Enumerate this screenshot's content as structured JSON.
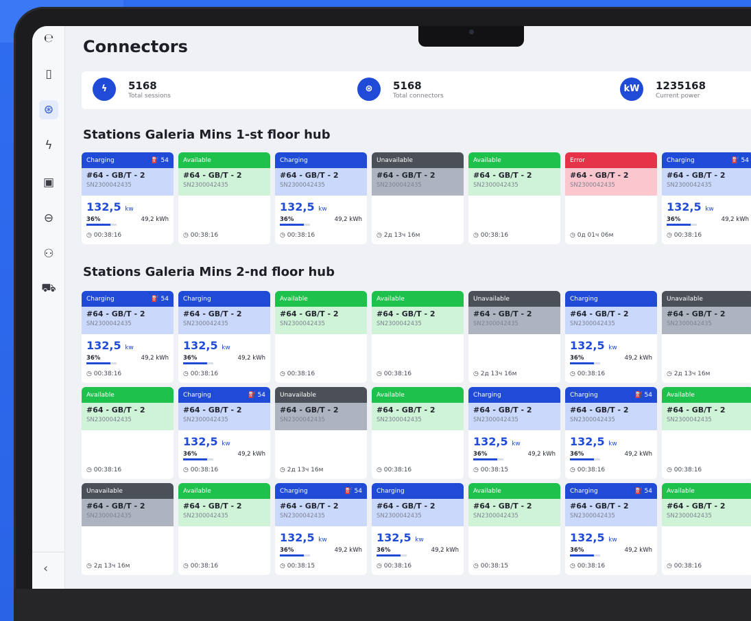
{
  "page": {
    "title": "Connectors"
  },
  "stats": [
    {
      "icon": "bolt-icon",
      "glyph": "ϟ",
      "value": "5168",
      "label": "Total sessions"
    },
    {
      "icon": "connector-icon",
      "glyph": "⊛",
      "value": "5168",
      "label": "Total connectors"
    },
    {
      "icon": "kw-icon",
      "glyph": "kW",
      "value": "1235168",
      "label": "Current power"
    }
  ],
  "sections": [
    {
      "title": "Stations Galeria Mins 1-st floor hub",
      "cards": [
        {
          "status": "Charging",
          "type": "charging",
          "conn": "⛽ 54",
          "name": "#64 - GB/T - 2",
          "sn": "SN2300042435",
          "power": "132,5",
          "unit": "kw",
          "pct": "36%",
          "pct_value": 0.36,
          "kwh": "49,2 kWh",
          "time": "00:38:16"
        },
        {
          "status": "Available",
          "type": "available",
          "conn": "",
          "name": "#64 - GB/T - 2",
          "sn": "SN2300042435",
          "power": "",
          "unit": "",
          "pct": "",
          "pct_value": 0,
          "kwh": "",
          "time": "00:38:16"
        },
        {
          "status": "Charging",
          "type": "charging",
          "conn": "",
          "name": "#64 - GB/T - 2",
          "sn": "SN2300042435",
          "power": "132,5",
          "unit": "kw",
          "pct": "36%",
          "pct_value": 0.36,
          "kwh": "49,2 kWh",
          "time": "00:38:16"
        },
        {
          "status": "Unavailable",
          "type": "unavailable",
          "conn": "",
          "name": "#64 - GB/T - 2",
          "sn": "SN2300042435",
          "power": "",
          "unit": "",
          "pct": "",
          "pct_value": 0,
          "kwh": "",
          "time": "2д 13ч 16м"
        },
        {
          "status": "Available",
          "type": "available",
          "conn": "",
          "name": "#64 - GB/T - 2",
          "sn": "SN2300042435",
          "power": "",
          "unit": "",
          "pct": "",
          "pct_value": 0,
          "kwh": "",
          "time": "00:38:16"
        },
        {
          "status": "Error",
          "type": "error",
          "conn": "",
          "name": "#64 - GB/T - 2",
          "sn": "SN2300042435",
          "power": "",
          "unit": "",
          "pct": "",
          "pct_value": 0,
          "kwh": "",
          "time": "0д 01ч 06м"
        },
        {
          "status": "Charging",
          "type": "charging",
          "conn": "⛽ 54",
          "name": "#64 - GB/T - 2",
          "sn": "SN2300042435",
          "power": "132,5",
          "unit": "kw",
          "pct": "36%",
          "pct_value": 0.36,
          "kwh": "49,2 kWh",
          "time": "00:38:16"
        }
      ]
    },
    {
      "title": "Stations Galeria Mins 2-nd floor hub",
      "cards": [
        {
          "status": "Charging",
          "type": "charging",
          "conn": "⛽ 54",
          "name": "#64 - GB/T - 2",
          "sn": "SN2300042435",
          "power": "132,5",
          "unit": "kw",
          "pct": "36%",
          "pct_value": 0.36,
          "kwh": "49,2 kWh",
          "time": "00:38:16"
        },
        {
          "status": "Charging",
          "type": "charging",
          "conn": "",
          "name": "#64 - GB/T - 2",
          "sn": "SN2300042435",
          "power": "132,5",
          "unit": "kw",
          "pct": "36%",
          "pct_value": 0.36,
          "kwh": "49,2 kWh",
          "time": "00:38:16"
        },
        {
          "status": "Available",
          "type": "available",
          "conn": "",
          "name": "#64 - GB/T - 2",
          "sn": "SN2300042435",
          "power": "",
          "unit": "",
          "pct": "",
          "pct_value": 0,
          "kwh": "",
          "time": "00:38:16"
        },
        {
          "status": "Available",
          "type": "available",
          "conn": "",
          "name": "#64 - GB/T - 2",
          "sn": "SN2300042435",
          "power": "",
          "unit": "",
          "pct": "",
          "pct_value": 0,
          "kwh": "",
          "time": "00:38:16"
        },
        {
          "status": "Unavailable",
          "type": "unavailable",
          "conn": "",
          "name": "#64 - GB/T - 2",
          "sn": "SN2300042435",
          "power": "",
          "unit": "",
          "pct": "",
          "pct_value": 0,
          "kwh": "",
          "time": "2д 13ч 16м"
        },
        {
          "status": "Charging",
          "type": "charging",
          "conn": "",
          "name": "#64 - GB/T - 2",
          "sn": "SN2300042435",
          "power": "132,5",
          "unit": "kw",
          "pct": "36%",
          "pct_value": 0.36,
          "kwh": "49,2 kWh",
          "time": "00:38:16"
        },
        {
          "status": "Unavailable",
          "type": "unavailable",
          "conn": "",
          "name": "#64 - GB/T - 2",
          "sn": "SN2300042435",
          "power": "",
          "unit": "",
          "pct": "",
          "pct_value": 0,
          "kwh": "",
          "time": "2д 13ч 16м"
        },
        {
          "status": "Available",
          "type": "available",
          "conn": "",
          "name": "#64 - GB/T - 2",
          "sn": "SN2300042435",
          "power": "",
          "unit": "",
          "pct": "",
          "pct_value": 0,
          "kwh": "",
          "time": "00:38:16"
        },
        {
          "status": "Charging",
          "type": "charging",
          "conn": "⛽ 54",
          "name": "#64 - GB/T - 2",
          "sn": "SN2300042435",
          "power": "132,5",
          "unit": "kw",
          "pct": "36%",
          "pct_value": 0.36,
          "kwh": "49,2 kWh",
          "time": "00:38:16"
        },
        {
          "status": "Unavailable",
          "type": "unavailable",
          "conn": "",
          "name": "#64 - GB/T - 2",
          "sn": "SN2300042435",
          "power": "",
          "unit": "",
          "pct": "",
          "pct_value": 0,
          "kwh": "",
          "time": "2д 13ч 16м"
        },
        {
          "status": "Available",
          "type": "available",
          "conn": "",
          "name": "#64 - GB/T - 2",
          "sn": "SN2300042435",
          "power": "",
          "unit": "",
          "pct": "",
          "pct_value": 0,
          "kwh": "",
          "time": "00:38:16"
        },
        {
          "status": "Charging",
          "type": "charging",
          "conn": "",
          "name": "#64 - GB/T - 2",
          "sn": "SN2300042435",
          "power": "132,5",
          "unit": "kw",
          "pct": "36%",
          "pct_value": 0.36,
          "kwh": "49,2 kWh",
          "time": "00:38:15"
        },
        {
          "status": "Charging",
          "type": "charging",
          "conn": "⛽ 54",
          "name": "#64 - GB/T - 2",
          "sn": "SN2300042435",
          "power": "132,5",
          "unit": "kw",
          "pct": "36%",
          "pct_value": 0.36,
          "kwh": "49,2 kWh",
          "time": "00:38:16"
        },
        {
          "status": "Available",
          "type": "available",
          "conn": "",
          "name": "#64 - GB/T - 2",
          "sn": "SN2300042435",
          "power": "",
          "unit": "",
          "pct": "",
          "pct_value": 0,
          "kwh": "",
          "time": "00:38:16"
        },
        {
          "status": "Unavailable",
          "type": "unavailable",
          "conn": "",
          "name": "#64 - GB/T - 2",
          "sn": "SN2300042435",
          "power": "",
          "unit": "",
          "pct": "",
          "pct_value": 0,
          "kwh": "",
          "time": "2д 13ч 16м"
        },
        {
          "status": "Available",
          "type": "available",
          "conn": "",
          "name": "#64 - GB/T - 2",
          "sn": "SN2300042435",
          "power": "",
          "unit": "",
          "pct": "",
          "pct_value": 0,
          "kwh": "",
          "time": "00:38:16"
        },
        {
          "status": "Charging",
          "type": "charging",
          "conn": "⛽ 54",
          "name": "#64 - GB/T - 2",
          "sn": "SN2300042435",
          "power": "132,5",
          "unit": "kw",
          "pct": "36%",
          "pct_value": 0.36,
          "kwh": "49,2 kWh",
          "time": "00:38:15"
        },
        {
          "status": "Charging",
          "type": "charging",
          "conn": "",
          "name": "#64 - GB/T - 2",
          "sn": "SN2300042435",
          "power": "132,5",
          "unit": "kw",
          "pct": "36%",
          "pct_value": 0.36,
          "kwh": "49,2 kWh",
          "time": "00:38:16"
        },
        {
          "status": "Available",
          "type": "available",
          "conn": "",
          "name": "#64 - GB/T - 2",
          "sn": "SN2300042435",
          "power": "",
          "unit": "",
          "pct": "",
          "pct_value": 0,
          "kwh": "",
          "time": "00:38:15"
        },
        {
          "status": "Charging",
          "type": "charging",
          "conn": "⛽ 54",
          "name": "#64 - GB/T - 2",
          "sn": "SN2300042435",
          "power": "132,5",
          "unit": "kw",
          "pct": "36%",
          "pct_value": 0.36,
          "kwh": "49,2 kWh",
          "time": "00:38:16"
        },
        {
          "status": "Available",
          "type": "available",
          "conn": "",
          "name": "#64 - GB/T - 2",
          "sn": "SN2300042435",
          "power": "",
          "unit": "",
          "pct": "",
          "pct_value": 0,
          "kwh": "",
          "time": "00:38:16"
        }
      ]
    }
  ],
  "sidebar": {
    "icons": [
      {
        "name": "logo-icon",
        "glyph": "℮",
        "active": false
      },
      {
        "name": "station-icon",
        "glyph": "▯",
        "active": false
      },
      {
        "name": "connector-icon",
        "glyph": "⊛",
        "active": true
      },
      {
        "name": "bolt-icon",
        "glyph": "ϟ",
        "active": false
      },
      {
        "name": "payment-icon",
        "glyph": "▣",
        "active": false
      },
      {
        "name": "plug-icon",
        "glyph": "⊖",
        "active": false
      },
      {
        "name": "users-icon",
        "glyph": "⚇",
        "active": false
      },
      {
        "name": "car-icon",
        "glyph": "⛟",
        "active": false
      }
    ],
    "collapse": "‹"
  },
  "colors": {
    "charging": "#1f4bd7",
    "available": "#1ec14b",
    "unavailable": "#4b5058",
    "error": "#e5334a"
  }
}
